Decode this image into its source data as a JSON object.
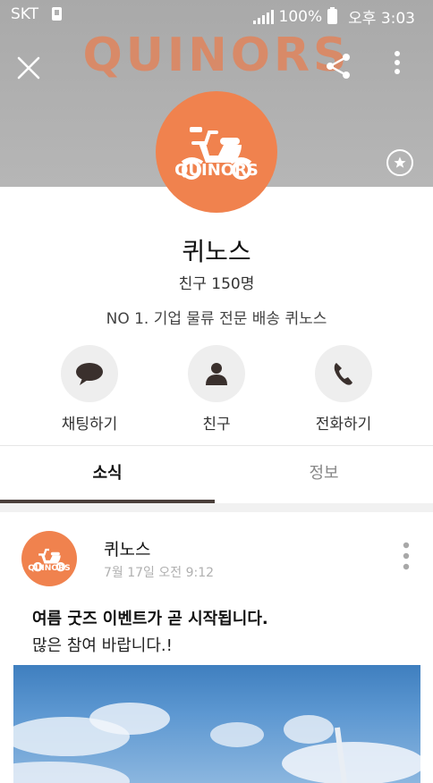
{
  "status_bar": {
    "carrier": "SKT",
    "battery": "100%",
    "time": "오후 3:03"
  },
  "cover": {
    "brand_watermark": "QUINORS"
  },
  "profile": {
    "name": "퀴노스",
    "friends": "친구 150명",
    "description": "NO 1. 기업 물류 전문 배송 퀴노스",
    "logo_text": "QUINORS"
  },
  "actions": [
    {
      "label": "채팅하기",
      "icon": "chat-bubble-icon"
    },
    {
      "label": "친구",
      "icon": "person-icon"
    },
    {
      "label": "전화하기",
      "icon": "phone-icon"
    }
  ],
  "tabs": {
    "news": "소식",
    "info": "정보"
  },
  "post": {
    "author": "퀴노스",
    "date": "7월 17일 오전 9:12",
    "headline": "여름 굿즈 이벤트가 곧 시작됩니다.",
    "body": "많은 참여 바랍니다.!",
    "logo_text": "QUINORS"
  },
  "colors": {
    "brand_orange": "#f0824e",
    "tab_indicator": "#4a3f3a",
    "cover_gray": "#b0b0b0"
  }
}
